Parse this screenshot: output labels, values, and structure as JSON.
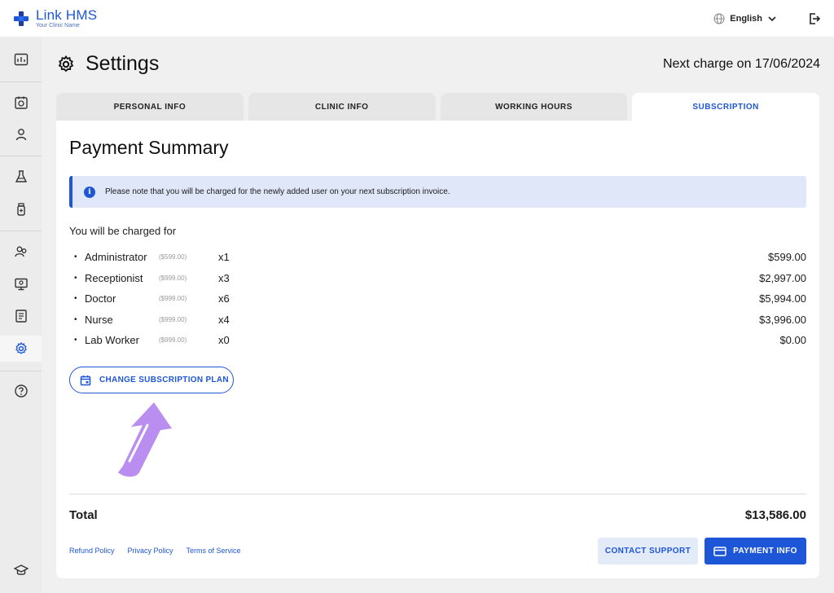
{
  "brand": {
    "name": "Link HMS",
    "subtitle": "Your Clinic Name"
  },
  "header": {
    "language": "English"
  },
  "page": {
    "title": "Settings",
    "next_charge": "Next charge on 17/06/2024"
  },
  "tabs": [
    {
      "label": "PERSONAL INFO",
      "active": false
    },
    {
      "label": "CLINIC INFO",
      "active": false
    },
    {
      "label": "WORKING HOURS",
      "active": false
    },
    {
      "label": "SUBSCRIPTION",
      "active": true
    }
  ],
  "summary": {
    "title": "Payment Summary",
    "notice": "Please note that you will be charged for the newly added user on your next subscription invoice.",
    "charged_label": "You will be charged for",
    "items": [
      {
        "role": "Administrator",
        "unit_price": "($599.00)",
        "qty": "x1",
        "amount": "$599.00"
      },
      {
        "role": "Receptionist",
        "unit_price": "($999.00)",
        "qty": "x3",
        "amount": "$2,997.00"
      },
      {
        "role": "Doctor",
        "unit_price": "($999.00)",
        "qty": "x6",
        "amount": "$5,994.00"
      },
      {
        "role": "Nurse",
        "unit_price": "($999.00)",
        "qty": "x4",
        "amount": "$3,996.00"
      },
      {
        "role": "Lab Worker",
        "unit_price": "($999.00)",
        "qty": "x0",
        "amount": "$0.00"
      }
    ],
    "change_plan_label": "CHANGE SUBSCRIPTION PLAN",
    "total_label": "Total",
    "total_amount": "$13,586.00"
  },
  "footer": {
    "links": [
      "Refund Policy",
      "Privacy Policy",
      "Terms of Service"
    ],
    "support_label": "CONTACT SUPPORT",
    "payment_label": "PAYMENT INFO"
  },
  "colors": {
    "accent": "#1e56d8",
    "notice_bg": "#dfe7f9",
    "arrow": "#b98ef0"
  },
  "sidebar_icons": [
    "dashboard-icon",
    "appointments-icon",
    "patients-icon",
    "lab-icon",
    "pharmacy-icon",
    "staff-icon",
    "monitor-icon",
    "reports-icon",
    "settings-icon",
    "help-icon",
    "education-icon"
  ]
}
